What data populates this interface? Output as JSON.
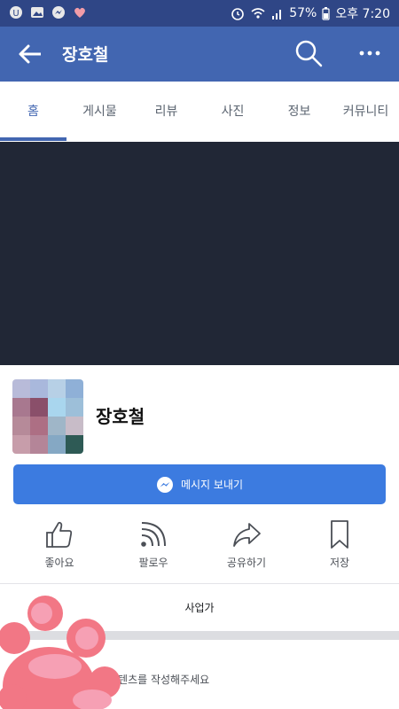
{
  "status_bar": {
    "battery": "57%",
    "time": "오후 7:20",
    "icons": [
      "u-plus-icon",
      "gallery-icon",
      "messenger-icon",
      "heart-icon",
      "alarm-icon",
      "wifi-icon",
      "signal-icon",
      "battery-icon"
    ]
  },
  "header": {
    "title": "장호철",
    "back_icon": "back-arrow-icon",
    "search_icon": "search-icon",
    "more_icon": "more-icon"
  },
  "tabs": [
    {
      "label": "홈",
      "active": true
    },
    {
      "label": "게시물",
      "active": false
    },
    {
      "label": "리뷰",
      "active": false
    },
    {
      "label": "사진",
      "active": false
    },
    {
      "label": "정보",
      "active": false
    },
    {
      "label": "커뮤니티",
      "active": false
    }
  ],
  "profile": {
    "name": "장호철"
  },
  "message_button": {
    "label": "메시지 보내기",
    "icon": "messenger-icon"
  },
  "actions": [
    {
      "label": "좋아요",
      "icon": "like-icon"
    },
    {
      "label": "팔로우",
      "icon": "follow-icon"
    },
    {
      "label": "공유하기",
      "icon": "share-icon"
    },
    {
      "label": "저장",
      "icon": "bookmark-icon"
    }
  ],
  "category": "사업가",
  "compose_placeholder": "콘텐츠를 작성해주세요",
  "colors": {
    "header": "#4266b1",
    "status_bar": "#2f4686",
    "message_button": "#3c7be0",
    "cover": "#212736",
    "paw_sticker": "#f07b86"
  }
}
